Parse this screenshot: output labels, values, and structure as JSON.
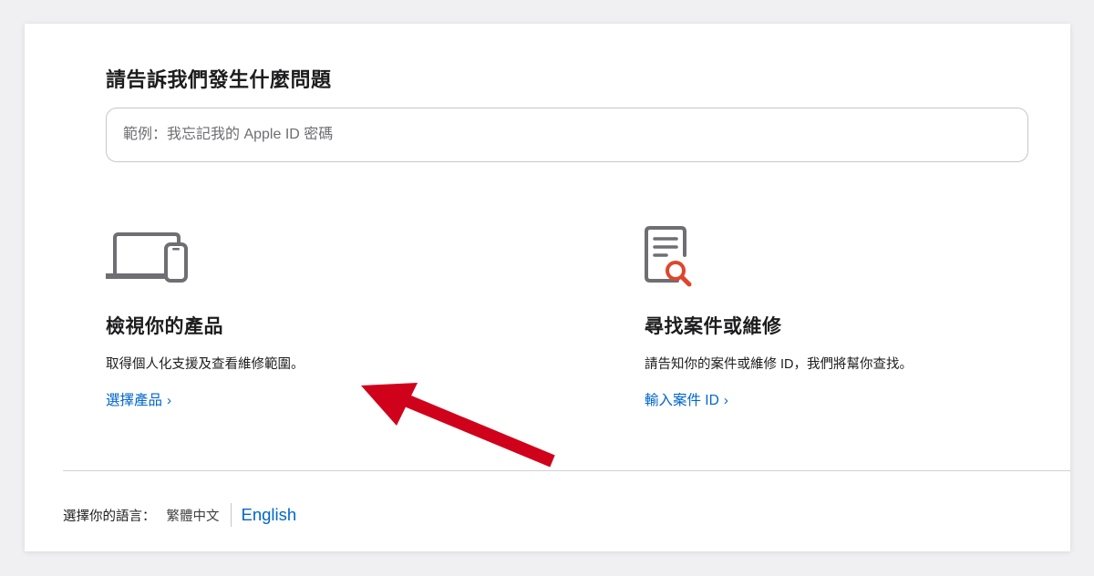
{
  "header": {
    "title": "請告訴我們發生什麼問題"
  },
  "search": {
    "placeholder": "範例：我忘記我的 Apple ID 密碼",
    "value": ""
  },
  "options": [
    {
      "icon": "laptop-phone-icon",
      "title": "檢視你的產品",
      "description": "取得個人化支援及查看維修範圍。",
      "link_label": "選擇產品",
      "link_chevron": "›"
    },
    {
      "icon": "document-search-icon",
      "title": "尋找案件或維修",
      "description": "請告知你的案件或維修 ID，我們將幫你查找。",
      "link_label": "輸入案件 ID",
      "link_chevron": "›"
    }
  ],
  "footer": {
    "language_label": "選擇你的語言：",
    "current_language": "繁體中文",
    "alternate_language": "English"
  },
  "annotation": {
    "icon": "red-arrow-icon",
    "color": "#d0021b"
  },
  "colors": {
    "link": "#0066cc",
    "icon_gray": "#6e6e73",
    "icon_accent": "#e0452b",
    "text": "#1d1d1f"
  }
}
